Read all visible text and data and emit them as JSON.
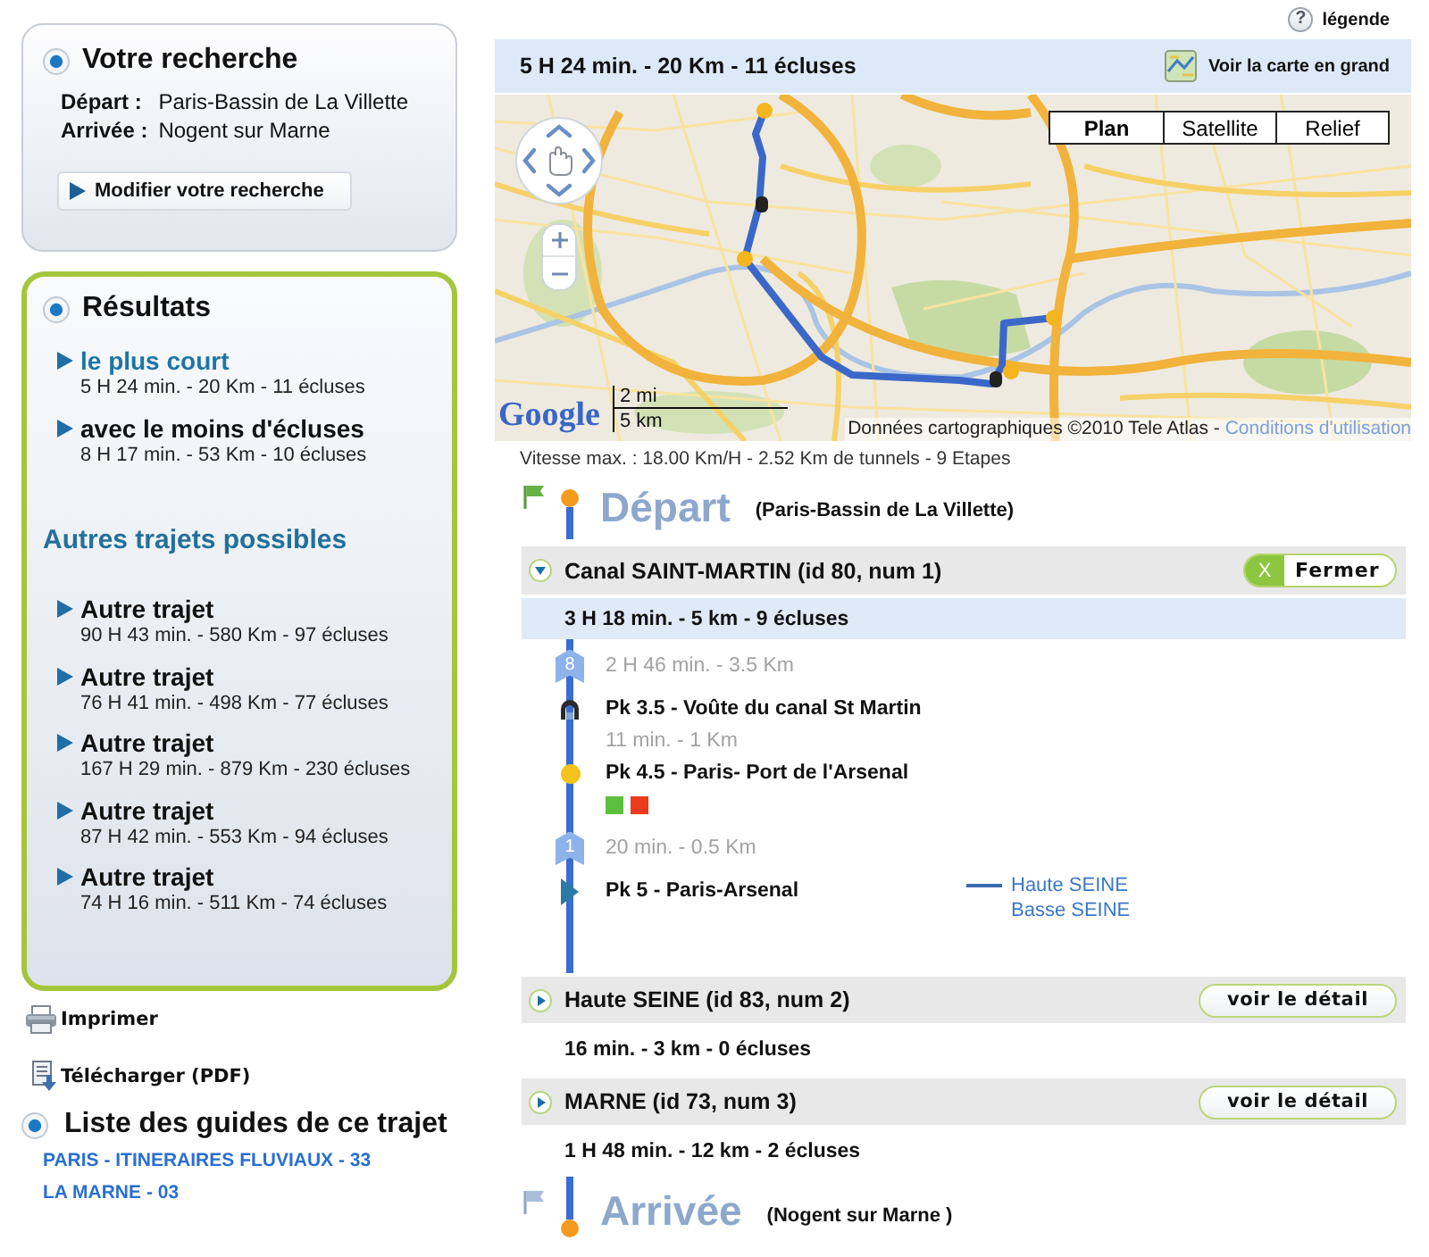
{
  "search": {
    "title": "Votre recherche",
    "fields": [
      {
        "label": "Départ :",
        "value": "Paris-Bassin de La Villette"
      },
      {
        "label": "Arrivée :",
        "value": "Nogent sur Marne"
      }
    ],
    "button": "Modifier votre recherche"
  },
  "results": {
    "title": "Résultats",
    "items": [
      {
        "label": "le plus court",
        "summary": "5 H 24 min. - 20 Km - 11 écluses",
        "selected": true
      },
      {
        "label": "avec le moins d'écluses",
        "summary": "8 H 17 min. - 53 Km - 10 écluses",
        "selected": false
      }
    ],
    "others_title": "Autres trajets possibles",
    "others": [
      {
        "label": "Autre trajet",
        "summary": "90 H 43 min. - 580 Km - 97 écluses",
        "selected": false
      },
      {
        "label": "Autre trajet",
        "summary": "76 H 41 min. - 498 Km - 77 écluses",
        "selected": false
      },
      {
        "label": "Autre trajet",
        "summary": "167 H 29 min. - 879 Km - 230 écluses",
        "selected": false
      },
      {
        "label": "Autre trajet",
        "summary": "87 H 42 min. - 553 Km - 94 écluses",
        "selected": false
      },
      {
        "label": "Autre trajet",
        "summary": "74 H 16 min. - 511 Km - 74 écluses",
        "selected": false
      }
    ]
  },
  "actions": [
    {
      "kind": "print",
      "label": "Imprimer"
    },
    {
      "kind": "download",
      "label": "Télécharger (PDF)"
    }
  ],
  "guides": {
    "title": "Liste des guides de ce trajet",
    "links": [
      "PARIS - ITINERAIRES FLUVIAUX - 33",
      "LA MARNE - 03"
    ]
  },
  "legend_link": {
    "glyph": "?",
    "label": "légende"
  },
  "route": {
    "summary": "5 H 24 min. - 20 Km - 11 écluses",
    "map_link": "Voir la carte en grand"
  },
  "map": {
    "types": [
      {
        "label": "Plan",
        "selected": true
      },
      {
        "label": "Satellite",
        "selected": false
      },
      {
        "label": "Relief",
        "selected": false
      }
    ],
    "scale": [
      "2 mi",
      "5 km"
    ],
    "logo": "Google",
    "attribution": "Données cartographiques ©2010 Tele Atlas - ",
    "terms_link": "Conditions d'utilisation"
  },
  "route_info": "Vitesse max. : 18.00 Km/H - 2.52 Km de tunnels - 9 Etapes",
  "start": {
    "title": "Départ",
    "place": "(Paris-Bassin de La Villette)"
  },
  "sections": [
    {
      "title": "Canal SAINT-MARTIN (id 80, num 1)",
      "expanded": true,
      "button_mark": "X",
      "button": "Fermer",
      "summary": "3 H 18 min. - 5 km - 9 écluses",
      "steps": [
        {
          "kind": "leg",
          "badge": "8",
          "text": "2 H 46 min. - 3.5 Km"
        },
        {
          "kind": "tunnel",
          "text": "Pk 3.5 - Voûte du canal St Martin"
        },
        {
          "kind": "leg",
          "text": "11 min. - 1 Km"
        },
        {
          "kind": "port",
          "text": "Pk 4.5 - Paris- Port de l'Arsenal",
          "swatches": [
            {
              "color": "#5cbf3e"
            },
            {
              "color": "#ec3b1c"
            }
          ]
        },
        {
          "kind": "leg",
          "badge": "1",
          "text": "20 min. - 0.5 Km"
        },
        {
          "kind": "junction",
          "text": "Pk 5 - Paris-Arsenal",
          "branches": [
            {
              "label": "Haute SEINE",
              "selected": true
            },
            {
              "label": "Basse SEINE",
              "selected": false
            }
          ]
        }
      ]
    },
    {
      "title": "Haute SEINE (id 83, num 2)",
      "expanded": false,
      "button": "voir le détail",
      "summary": "16 min. - 3 km - 0 écluses"
    },
    {
      "title": "MARNE (id 73, num 3)",
      "expanded": false,
      "button": "voir le détail",
      "summary": "1 H 48 min. - 12 km - 2 écluses"
    }
  ],
  "end": {
    "title": "Arrivée",
    "place": "(Nogent sur Marne )"
  }
}
